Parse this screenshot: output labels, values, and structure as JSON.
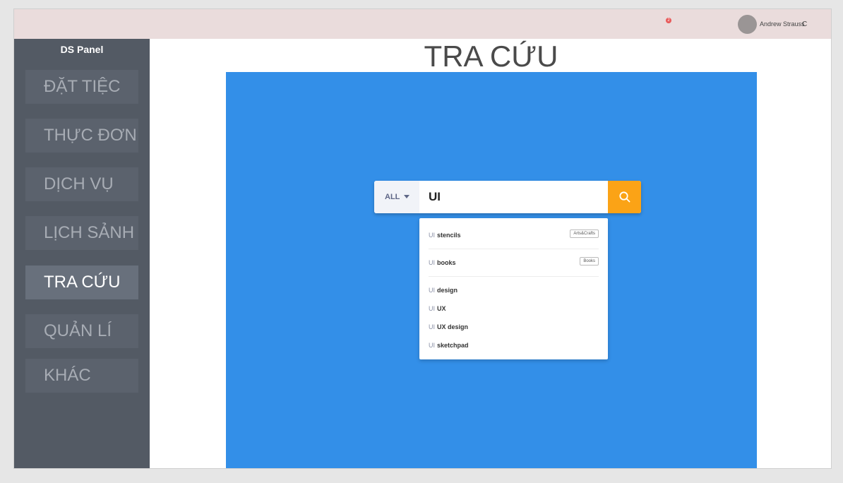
{
  "header": {
    "notification_count": "2",
    "user_name": "Andrew Strauss",
    "user_menu_caret": "C"
  },
  "sidebar": {
    "title": "DS Panel",
    "items": [
      {
        "label": "ĐẶT TIỆC",
        "active": false
      },
      {
        "label": "THỰC ĐƠN",
        "active": false
      },
      {
        "label": "DỊCH VỤ",
        "active": false
      },
      {
        "label": "LỊCH SẢNH",
        "active": false
      },
      {
        "label": "TRA CỨU",
        "active": true
      },
      {
        "label": "QUẢN LÍ",
        "active": false
      },
      {
        "label": "KHÁC",
        "active": false
      }
    ]
  },
  "main": {
    "title": "TRA CỨU",
    "search": {
      "filter_label": "ALL",
      "value": "UI",
      "button_icon": "search-icon"
    },
    "suggestions": [
      {
        "query": "UI",
        "rest": "stencils",
        "tag": "Arts&Crafts"
      },
      {
        "query": "UI",
        "rest": "books",
        "tag": "Books"
      },
      {
        "query": "UI",
        "rest": "design"
      },
      {
        "query": "UI",
        "rest": "UX"
      },
      {
        "query": "UI",
        "rest": "UX design"
      },
      {
        "query": "UI",
        "rest": "sketchpad"
      }
    ]
  },
  "colors": {
    "topbar": "#eadcdc",
    "sidebar": "#535a64",
    "panel_blue": "#338fe8",
    "search_button": "#fba316"
  }
}
